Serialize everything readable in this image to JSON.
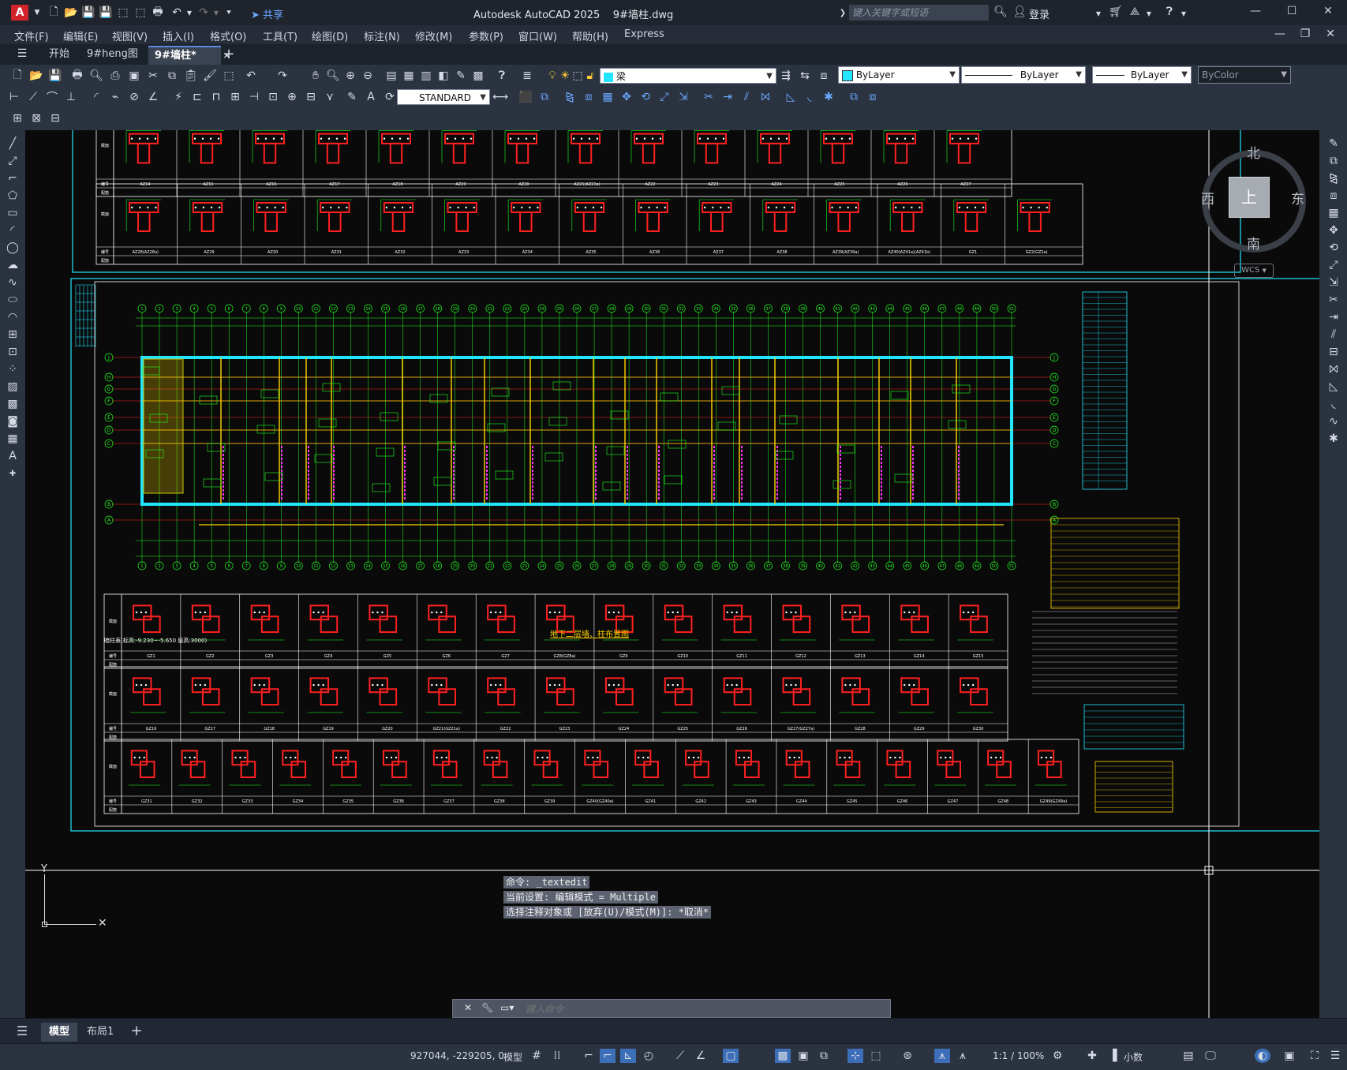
{
  "app": {
    "title": "Autodesk AutoCAD 2025",
    "document": "9#墙柱.dwg",
    "share_label": "共享",
    "search_placeholder": "键入关键字或短语",
    "login_label": "登录",
    "logo_letter": "A"
  },
  "menu": [
    "文件(F)",
    "编辑(E)",
    "视图(V)",
    "插入(I)",
    "格式(O)",
    "工具(T)",
    "绘图(D)",
    "标注(N)",
    "修改(M)",
    "参数(P)",
    "窗口(W)",
    "帮助(H)",
    "Express"
  ],
  "file_tabs": [
    {
      "label": "开始",
      "active": false
    },
    {
      "label": "9#heng图",
      "active": false
    },
    {
      "label": "9#墙柱*",
      "active": true
    }
  ],
  "toolbar": {
    "layer_name": "梁",
    "color": "ByLayer",
    "linetype": "ByLayer",
    "lineweight": "ByLayer",
    "plotstyle": "ByColor",
    "textstyle": "STANDARD"
  },
  "viewcube": {
    "north": "北",
    "south": "南",
    "east": "东",
    "west": "西",
    "top": "上",
    "wcs": "WCS"
  },
  "drawing": {
    "plan_title": "地下二层墙、柱布置图",
    "table_header_note": "暗柱表(标高:-9.230~-5.650 层高:3000)",
    "row_label_section": "截面",
    "row_label_number": "编号",
    "row_label_rebar": "配筋",
    "upper_row1_ids": [
      "AZ14",
      "AZ15",
      "AZ16",
      "AZ17",
      "AZ18",
      "AZ19",
      "AZ20",
      "AZ21(AZ21a)",
      "AZ22",
      "AZ23",
      "AZ24",
      "AZ25",
      "AZ26",
      "AZ27"
    ],
    "upper_row2_ids": [
      "AZ28(AZ28a)",
      "AZ29",
      "AZ30",
      "AZ31",
      "AZ32",
      "AZ33",
      "AZ34",
      "AZ35",
      "AZ36",
      "AZ37",
      "AZ38",
      "AZ39(AZ39a)",
      "AZ40(AZ41a)(AZ41b)",
      "GZ1",
      "GZ2(GZ2a)"
    ],
    "lower_row1_ids": [
      "GZ1",
      "GZ2",
      "GZ3",
      "GZ4",
      "GZ5",
      "GZ6",
      "GZ7",
      "GZ8(GZ8a)",
      "GZ9",
      "GZ10",
      "GZ11",
      "GZ12",
      "GZ13",
      "GZ14",
      "GZ15"
    ],
    "lower_row2_ids": [
      "GZ16",
      "GZ17",
      "GZ18",
      "GZ19",
      "GZ20",
      "GZ21(GZ21a)",
      "GZ22",
      "GZ23",
      "GZ24",
      "GZ25",
      "GZ26",
      "GZ27(GZ27a)",
      "GZ28",
      "GZ29",
      "GZ30"
    ],
    "lower_row3_ids": [
      "GZ31",
      "GZ32",
      "GZ33",
      "GZ34",
      "GZ35",
      "GZ36",
      "GZ37",
      "GZ38",
      "GZ39",
      "GZ40(GZ40a)",
      "GZ41",
      "GZ42",
      "GZ43",
      "GZ44",
      "GZ45",
      "GZ46",
      "GZ47",
      "GZ48",
      "GZ49(GZ49a)"
    ],
    "axis_labels_top": [
      "1",
      "2",
      "3",
      "4",
      "5",
      "6",
      "7",
      "8",
      "9",
      "10",
      "11",
      "12",
      "13",
      "14",
      "15",
      "16",
      "17",
      "18",
      "19",
      "20",
      "21",
      "22",
      "23",
      "24",
      "25",
      "26",
      "27",
      "28",
      "29",
      "30",
      "31",
      "32",
      "33",
      "34",
      "35",
      "36",
      "37",
      "38",
      "39",
      "40",
      "41",
      "42",
      "43",
      "44",
      "45",
      "46",
      "47",
      "48",
      "49",
      "50",
      "51"
    ],
    "axis_labels_side": [
      "J",
      "H",
      "G",
      "F",
      "E",
      "D",
      "C",
      "B",
      "A"
    ]
  },
  "command": {
    "history": [
      "命令: _textedit",
      "当前设置: 编辑模式 = Multiple",
      "选择注释对象或 [放弃(U)/模式(M)]: *取消*"
    ],
    "placeholder": "键入命令"
  },
  "layout_tabs": [
    {
      "label": "模型",
      "active": true
    },
    {
      "label": "布局1",
      "active": false
    }
  ],
  "status": {
    "coords": "927044, -229205, 0",
    "model": "模型",
    "scale": "1:1 / 100%",
    "units": "小数"
  },
  "colors": {
    "canvas": "#0a0a0a",
    "red": "#ff2020",
    "green": "#22ff22",
    "cyan": "#22e6ff",
    "yellow": "#ffd400",
    "magenta": "#ff30ff",
    "white": "#ffffff"
  }
}
